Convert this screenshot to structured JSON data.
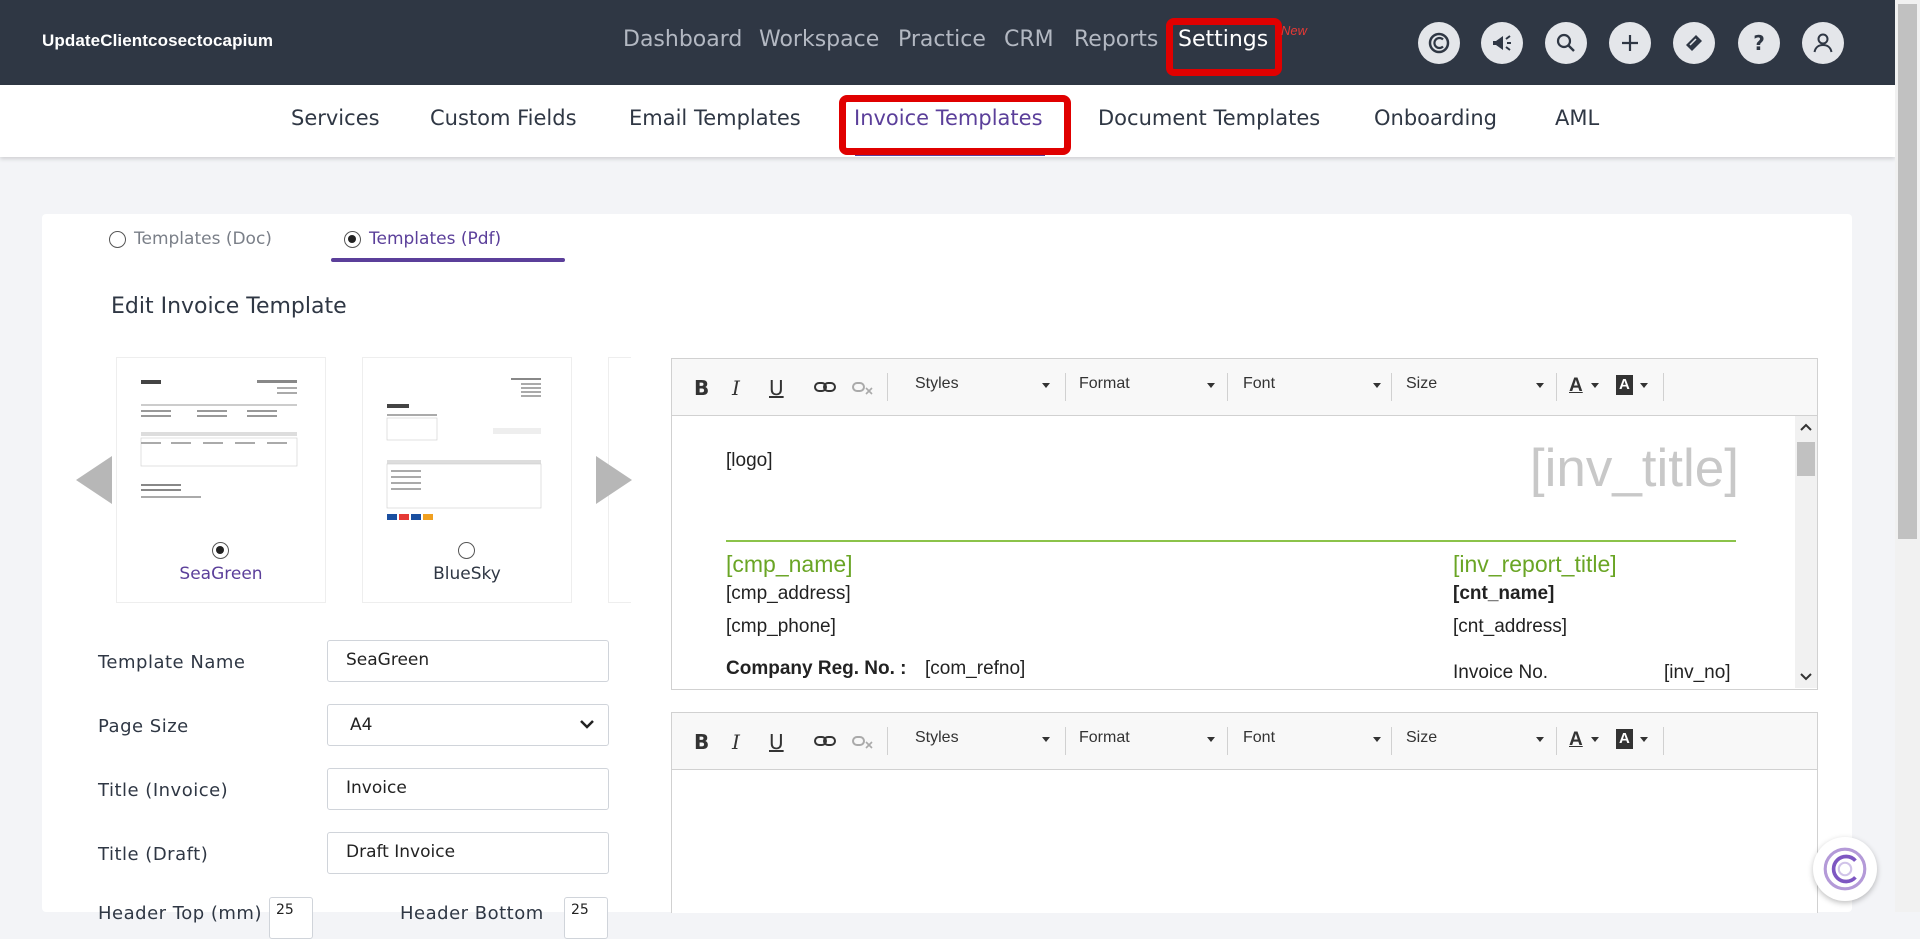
{
  "brand": "UpdateClientcosectocapium",
  "main_nav": [
    {
      "label": "Dashboard"
    },
    {
      "label": "Workspace"
    },
    {
      "label": "Practice"
    },
    {
      "label": "CRM"
    },
    {
      "label": "Reports"
    },
    {
      "label": "Settings"
    }
  ],
  "new_tag": "New",
  "top_icons": [
    "capium-logo-icon",
    "megaphone-icon",
    "search-icon",
    "plus-icon",
    "ticket-icon",
    "help-icon",
    "user-icon"
  ],
  "sub_nav": [
    {
      "label": "Services"
    },
    {
      "label": "Custom Fields"
    },
    {
      "label": "Email Templates"
    },
    {
      "label": "Invoice Templates"
    },
    {
      "label": "Document Templates"
    },
    {
      "label": "Onboarding"
    },
    {
      "label": "AML"
    }
  ],
  "template_tabs": [
    {
      "label": "Templates (Doc)",
      "selected": false
    },
    {
      "label": "Templates (Pdf)",
      "selected": true
    }
  ],
  "section_title": "Edit Invoice Template",
  "thumbnails": [
    {
      "name": "SeaGreen",
      "selected": true
    },
    {
      "name": "BlueSky",
      "selected": false
    }
  ],
  "form": {
    "template_name": {
      "label": "Template Name",
      "value": "SeaGreen"
    },
    "page_size": {
      "label": "Page Size",
      "value": "A4"
    },
    "title_invoice": {
      "label": "Title (Invoice)",
      "value": "Invoice"
    },
    "title_draft": {
      "label": "Title (Draft)",
      "value": "Draft Invoice"
    },
    "header_margin": {
      "label": "Header Top (mm)",
      "value": "25"
    },
    "header_bottom": {
      "label": "Header Bottom",
      "value": "25"
    }
  },
  "toolbar": {
    "styles": "Styles",
    "format": "Format",
    "font": "Font",
    "size": "Size",
    "bold": "B",
    "italic": "I",
    "underline": "U",
    "font_color": "A",
    "bg_color": "A"
  },
  "document": {
    "logo": "[logo]",
    "inv_title": "[inv_title]",
    "cmp_name": "[cmp_name]",
    "cmp_address": "[cmp_address]",
    "cmp_phone": "[cmp_phone]",
    "company_reg_label": "Company Reg. No. :",
    "com_refno": "[com_refno]",
    "inv_report_title": "[inv_report_title]",
    "cnt_name": "[cnt_name]",
    "cnt_address": "[cnt_address]",
    "invoice_no_label": "Invoice No.",
    "inv_no": "[inv_no]"
  },
  "colors": {
    "topbar": "#2f3744",
    "accent_purple": "#5b3f9a",
    "highlight_red": "#e00000",
    "doc_green": "#6aa525"
  }
}
